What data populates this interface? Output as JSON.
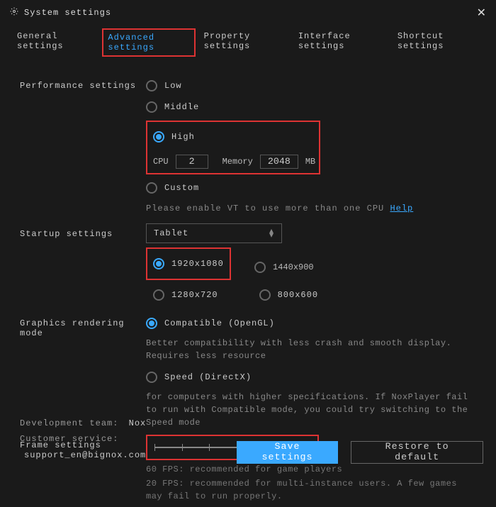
{
  "window": {
    "title": "System settings"
  },
  "tabs": {
    "general": "General settings",
    "advanced": "Advanced settings",
    "property": "Property settings",
    "interface": "Interface settings",
    "shortcut": "Shortcut settings"
  },
  "performance": {
    "label": "Performance settings",
    "low": "Low",
    "middle": "Middle",
    "high": "High",
    "cpu_label": "CPU",
    "cpu_value": "2",
    "memory_label": "Memory",
    "memory_value": "2048",
    "memory_unit": "MB",
    "custom": "Custom",
    "vt_hint": "Please enable VT to use more than one CPU",
    "help": "Help"
  },
  "startup": {
    "label": "Startup settings",
    "selected": "Tablet",
    "res1": "1920x1080",
    "res2": "1440x900",
    "res3": "1280x720",
    "res4": "800x600"
  },
  "graphics": {
    "label": "Graphics rendering mode",
    "compatible": "Compatible (OpenGL)",
    "compatible_desc": "Better compatibility with less crash and smooth display. Requires less resource",
    "speed": "Speed (DirectX)",
    "speed_desc": "for computers with higher specifications. If NoxPlayer fail to run with Compatible mode, you could try switching to the Speed mode"
  },
  "frame": {
    "label": "Frame settings",
    "value": "60",
    "hint60": "60 FPS: recommended for game players",
    "hint20": "20 FPS: recommended for multi-instance users. A few games may fail to run properly."
  },
  "footer": {
    "dev_label": "Development team:",
    "dev_value": "Nox",
    "cs_label": "Customer service:",
    "cs_value": "support_en@bignox.com",
    "save": "Save settings",
    "restore": "Restore to default"
  }
}
